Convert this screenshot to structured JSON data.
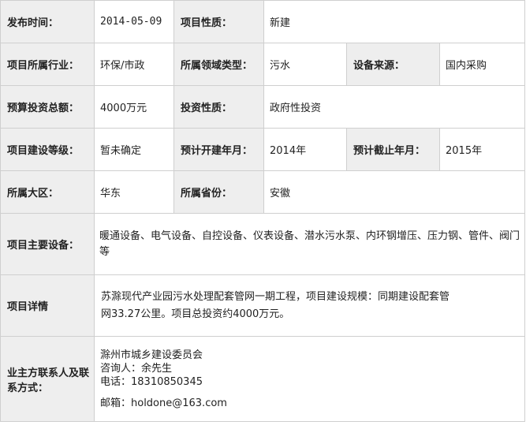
{
  "publish_time": {
    "label": "发布时间：",
    "value": "2014-05-09"
  },
  "project_nature": {
    "label": "项目性质：",
    "value": "新建"
  },
  "industry": {
    "label": "项目所属行业：",
    "value": "环保/市政"
  },
  "domain_type": {
    "label": "所属领域类型：",
    "value": "污水"
  },
  "equipment_source": {
    "label": "设备来源：",
    "value": "国内采购"
  },
  "budget": {
    "label": "预算投资总额：",
    "value": "4000万元"
  },
  "investment_nature": {
    "label": "投资性质：",
    "value": "政府性投资"
  },
  "construction_level": {
    "label": "项目建设等级：",
    "value": "暂未确定"
  },
  "expected_start": {
    "label": "预计开建年月：",
    "value": "2014年"
  },
  "expected_end": {
    "label": "预计截止年月：",
    "value": "2015年"
  },
  "region": {
    "label": "所属大区：",
    "value": "华东"
  },
  "province": {
    "label": "所属省份：",
    "value": "安徽"
  },
  "main_equipment": {
    "label": "项目主要设备：",
    "value": "暖通设备、电气设备、自控设备、仪表设备、潜水污水泵、内环钢增压、压力钢、管件、阀门等"
  },
  "details": {
    "label": "项目详情",
    "line1": "苏滁现代产业园污水处理配套管网一期工程，项目建设规模：同期建设配套管",
    "line2": "网33.27公里。项目总投资约4000万元。"
  },
  "contact": {
    "label": "业主方联系人及联系方式：",
    "org": "滁州市城乡建设委员会",
    "consultant": "咨询人：余先生",
    "phone": "电话：18310850345",
    "email": "邮箱：holdone@163.com"
  }
}
